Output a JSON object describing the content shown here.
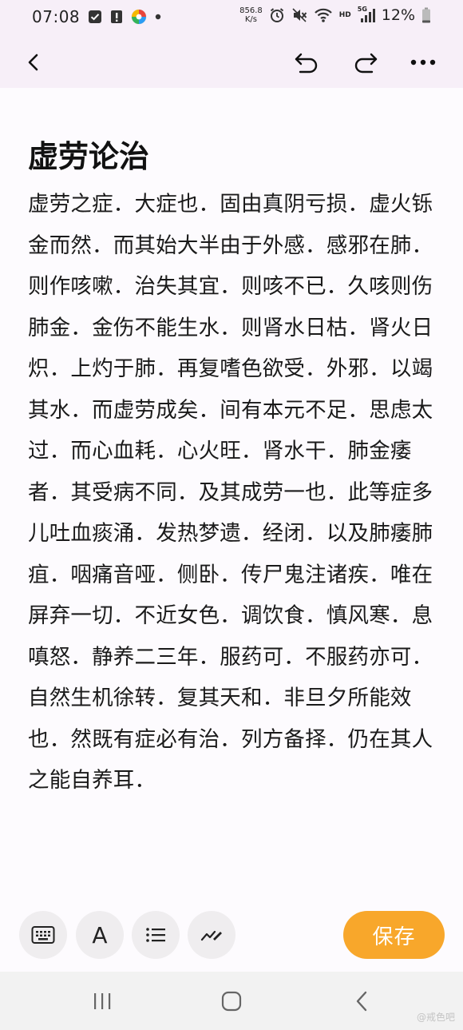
{
  "status_bar": {
    "time": "07:08",
    "net_speed_value": "856.8",
    "net_speed_unit": "K/s",
    "network_badge": "HD",
    "signal_badge": "5G",
    "battery_percent": "12%",
    "icons": [
      "checkbox-icon",
      "alert-icon",
      "app-colorful-icon",
      "dot-icon",
      "alarm-icon",
      "mute-icon",
      "wifi-icon",
      "signal-icon",
      "battery-icon"
    ]
  },
  "toolbar": {
    "icons": [
      "back-icon",
      "undo-icon",
      "redo-icon",
      "more-icon"
    ]
  },
  "note": {
    "title": "虚劳论治",
    "body": "虚劳之症．大症也．固由真阴亏损．虚火铄金而然．而其始大半由于外感．感邪在肺．则作咳嗽．治失其宜．则咳不已．久咳则伤肺金．金伤不能生水．则肾水日枯．肾火日炽．上灼于肺．再复嗜色欲受．外邪．以竭其水．而虚劳成矣．间有本元不足．思虑太过．而心血耗．心火旺．肾水干．肺金痿者．其受病不同．及其成劳一也．此等症多儿吐血痰涌．发热梦遗．经闭．以及肺痿肺疽．咽痛音哑．侧卧．传尸鬼注诸疾．唯在屏弃一切．不近女色．调饮食．慎风寒．息嗔怒．静养二三年．服药可．不服药亦可．自然生机徐转．复其天和．非旦夕所能效也．然既有症必有治．列方备择．仍在其人之能自养耳．"
  },
  "edit_bar": {
    "tools": [
      "keyboard-icon",
      "text-format-icon",
      "list-icon",
      "drawing-icon"
    ],
    "text_format_glyph": "A",
    "save_label": "保存",
    "save_color": "#f8a72b"
  },
  "nav_bar": {
    "icons": [
      "recent-apps-icon",
      "home-icon",
      "back-nav-icon"
    ],
    "watermark": "@戒色吧"
  },
  "colors": {
    "header_bg": "#f7eff8",
    "page_bg": "#fdfbfe",
    "accent": "#f8a72b",
    "nav_bg": "#f2f2f2"
  }
}
